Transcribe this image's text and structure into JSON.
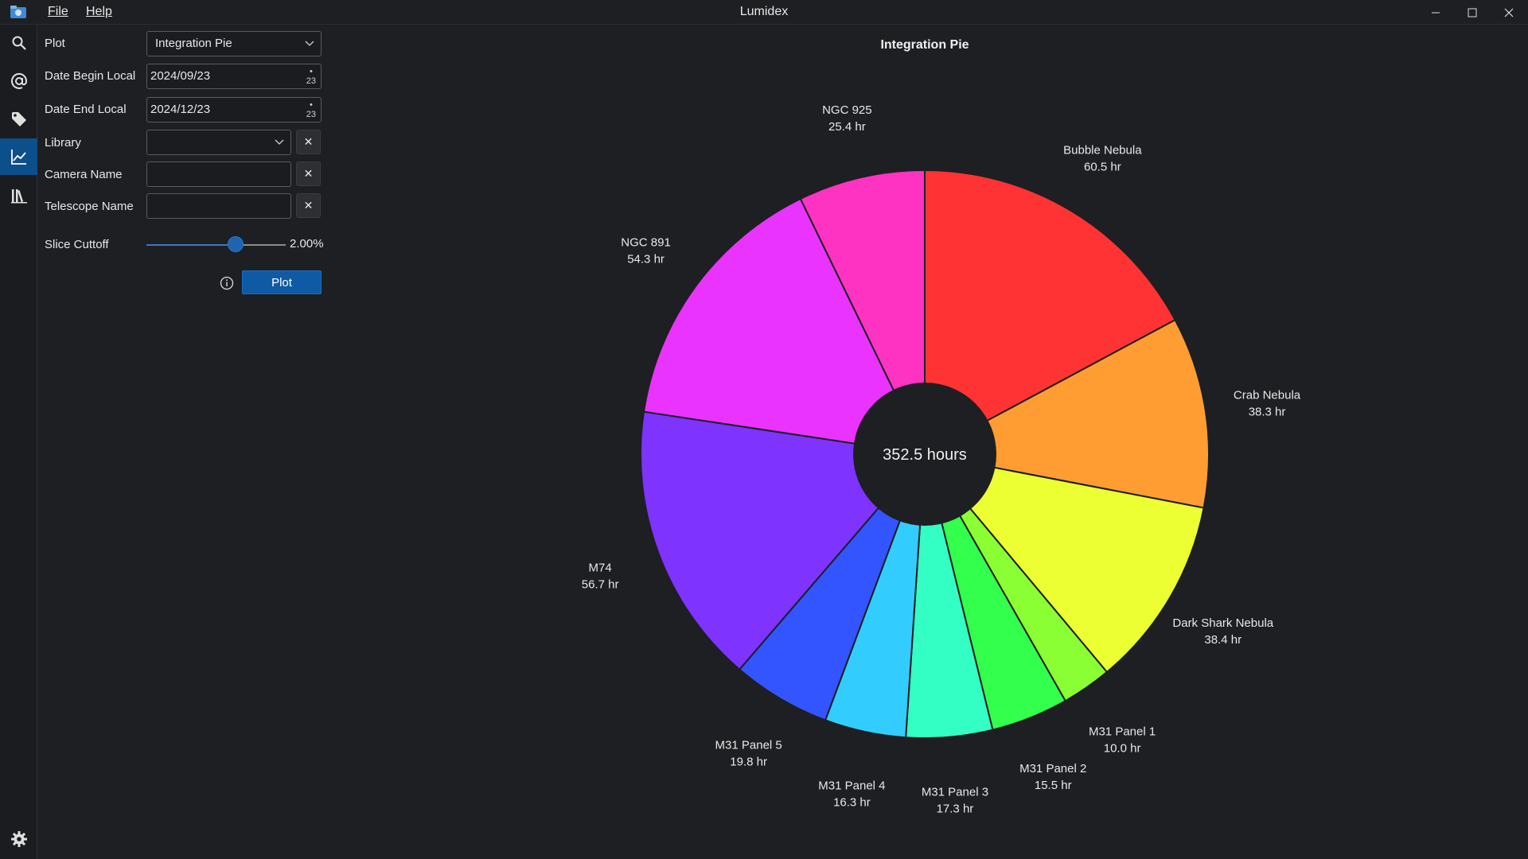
{
  "window": {
    "title": "Lumidex",
    "menu": [
      "File",
      "Help"
    ]
  },
  "rail": {
    "icons": [
      "search-icon",
      "at-sign-icon",
      "tag-icon",
      "chart-icon",
      "library-icon"
    ],
    "active": "chart-icon",
    "bottom_icon": "gear-icon"
  },
  "form": {
    "plot_label": "Plot",
    "plot_value": "Integration Pie",
    "date_begin_label": "Date Begin Local",
    "date_begin_value": "2024/09/23",
    "date_end_label": "Date End Local",
    "date_end_value": "2024/12/23",
    "calendar_day": "23",
    "library_label": "Library",
    "library_value": "",
    "camera_label": "Camera Name",
    "camera_value": "",
    "telescope_label": "Telescope Name",
    "telescope_value": "",
    "slice_label": "Slice Cuttoff",
    "slice_value": "2.00%",
    "slice_fraction": 0.64,
    "plot_button": "Plot"
  },
  "colors": {
    "accent": "#0f5aa5",
    "background": "#1e1f22"
  },
  "chart_data": {
    "type": "pie",
    "title": "Integration Pie",
    "center_label": "352.5 hours",
    "donut": true,
    "slices": [
      {
        "name": "Bubble Nebula",
        "value": 60.5,
        "label": "60.5 hr",
        "color": "#ff3333"
      },
      {
        "name": "Crab Nebula",
        "value": 38.3,
        "label": "38.3 hr",
        "color": "#ff9d33"
      },
      {
        "name": "Dark Shark Nebula",
        "value": 38.4,
        "label": "38.4 hr",
        "color": "#ebff33"
      },
      {
        "name": "M31 Panel 1",
        "value": 10.0,
        "label": "10.0 hr",
        "color": "#8aff33"
      },
      {
        "name": "M31 Panel 2",
        "value": 15.5,
        "label": "15.5 hr",
        "color": "#33ff4d"
      },
      {
        "name": "M31 Panel 3",
        "value": 17.3,
        "label": "17.3 hr",
        "color": "#33ffc4"
      },
      {
        "name": "M31 Panel 4",
        "value": 16.3,
        "label": "16.3 hr",
        "color": "#33ccff"
      },
      {
        "name": "M31 Panel 5",
        "value": 19.8,
        "label": "19.8 hr",
        "color": "#3355ff"
      },
      {
        "name": "M74",
        "value": 56.7,
        "label": "56.7 hr",
        "color": "#7f33ff"
      },
      {
        "name": "NGC 891",
        "value": 54.3,
        "label": "54.3 hr",
        "color": "#eb33ff"
      },
      {
        "name": "NGC 925",
        "value": 25.4,
        "label": "25.4 hr",
        "color": "#ff33c1"
      }
    ]
  }
}
